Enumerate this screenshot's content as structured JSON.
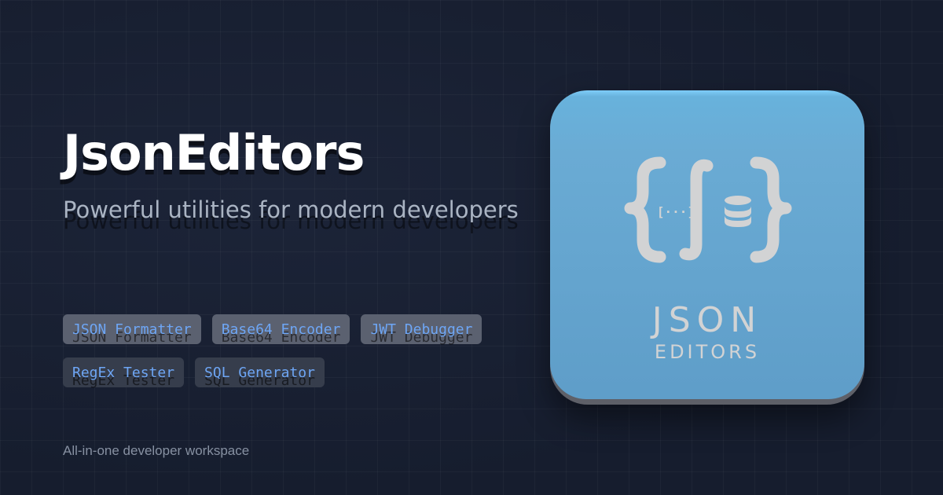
{
  "hero": {
    "title": "JsonEditors",
    "tagline": "Powerful utilities for modern developers"
  },
  "tools": [
    {
      "label": "JSON Formatter",
      "style": "light"
    },
    {
      "label": "Base64 Encoder",
      "style": "light"
    },
    {
      "label": "JWT Debugger",
      "style": "light"
    },
    {
      "label": "RegEx Tester",
      "style": "dark"
    },
    {
      "label": "SQL Generator",
      "style": "dark"
    }
  ],
  "footer": {
    "note": "All-in-one developer workspace"
  },
  "logo": {
    "icon": "json-editors-logo-icon",
    "line1": "JSON",
    "line2": "EDITORS",
    "ellipsis_glyph": "[···]"
  },
  "colors": {
    "background": "#161d2e",
    "accent_text": "#6ea6f5",
    "icon_blue": "#67a9d4",
    "icon_glyph": "#d2d3d4"
  }
}
